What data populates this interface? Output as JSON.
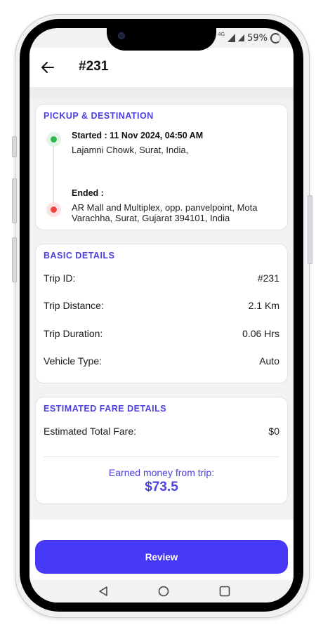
{
  "status": {
    "network": "4G",
    "battery": "59%"
  },
  "header": {
    "title": "#231"
  },
  "pickup": {
    "heading": "PICKUP & DESTINATION",
    "start_label": "Started : 11 Nov 2024, 04:50 AM",
    "start_address": "Lajamni Chowk, Surat, India,",
    "end_label": "Ended :",
    "end_address": "AR Mall and Multiplex, opp. panvelpoint, Mota Varachha, Surat, Gujarat 394101, India"
  },
  "basic": {
    "heading": "BASIC DETAILS",
    "rows": [
      {
        "label": "Trip ID:",
        "value": "#231"
      },
      {
        "label": "Trip Distance:",
        "value": "2.1 Km"
      },
      {
        "label": "Trip Duration:",
        "value": "0.06 Hrs"
      },
      {
        "label": "Vehicle Type:",
        "value": "Auto"
      }
    ]
  },
  "fare": {
    "heading": "ESTIMATED FARE DETAILS",
    "total_label": "Estimated Total Fare:",
    "total_value": "$0",
    "earned_label": "Earned money from trip:",
    "earned_value": "$73.5"
  },
  "actions": {
    "review_label": "Review"
  },
  "colors": {
    "accent": "#4638f7",
    "heading": "#4b3fe0",
    "start_dot": "#2fb84f",
    "end_dot": "#ef4545"
  },
  "icons": [
    "back-arrow-icon",
    "signal-icon",
    "battery-icon",
    "nav-back-icon",
    "nav-home-icon",
    "nav-recents-icon"
  ]
}
